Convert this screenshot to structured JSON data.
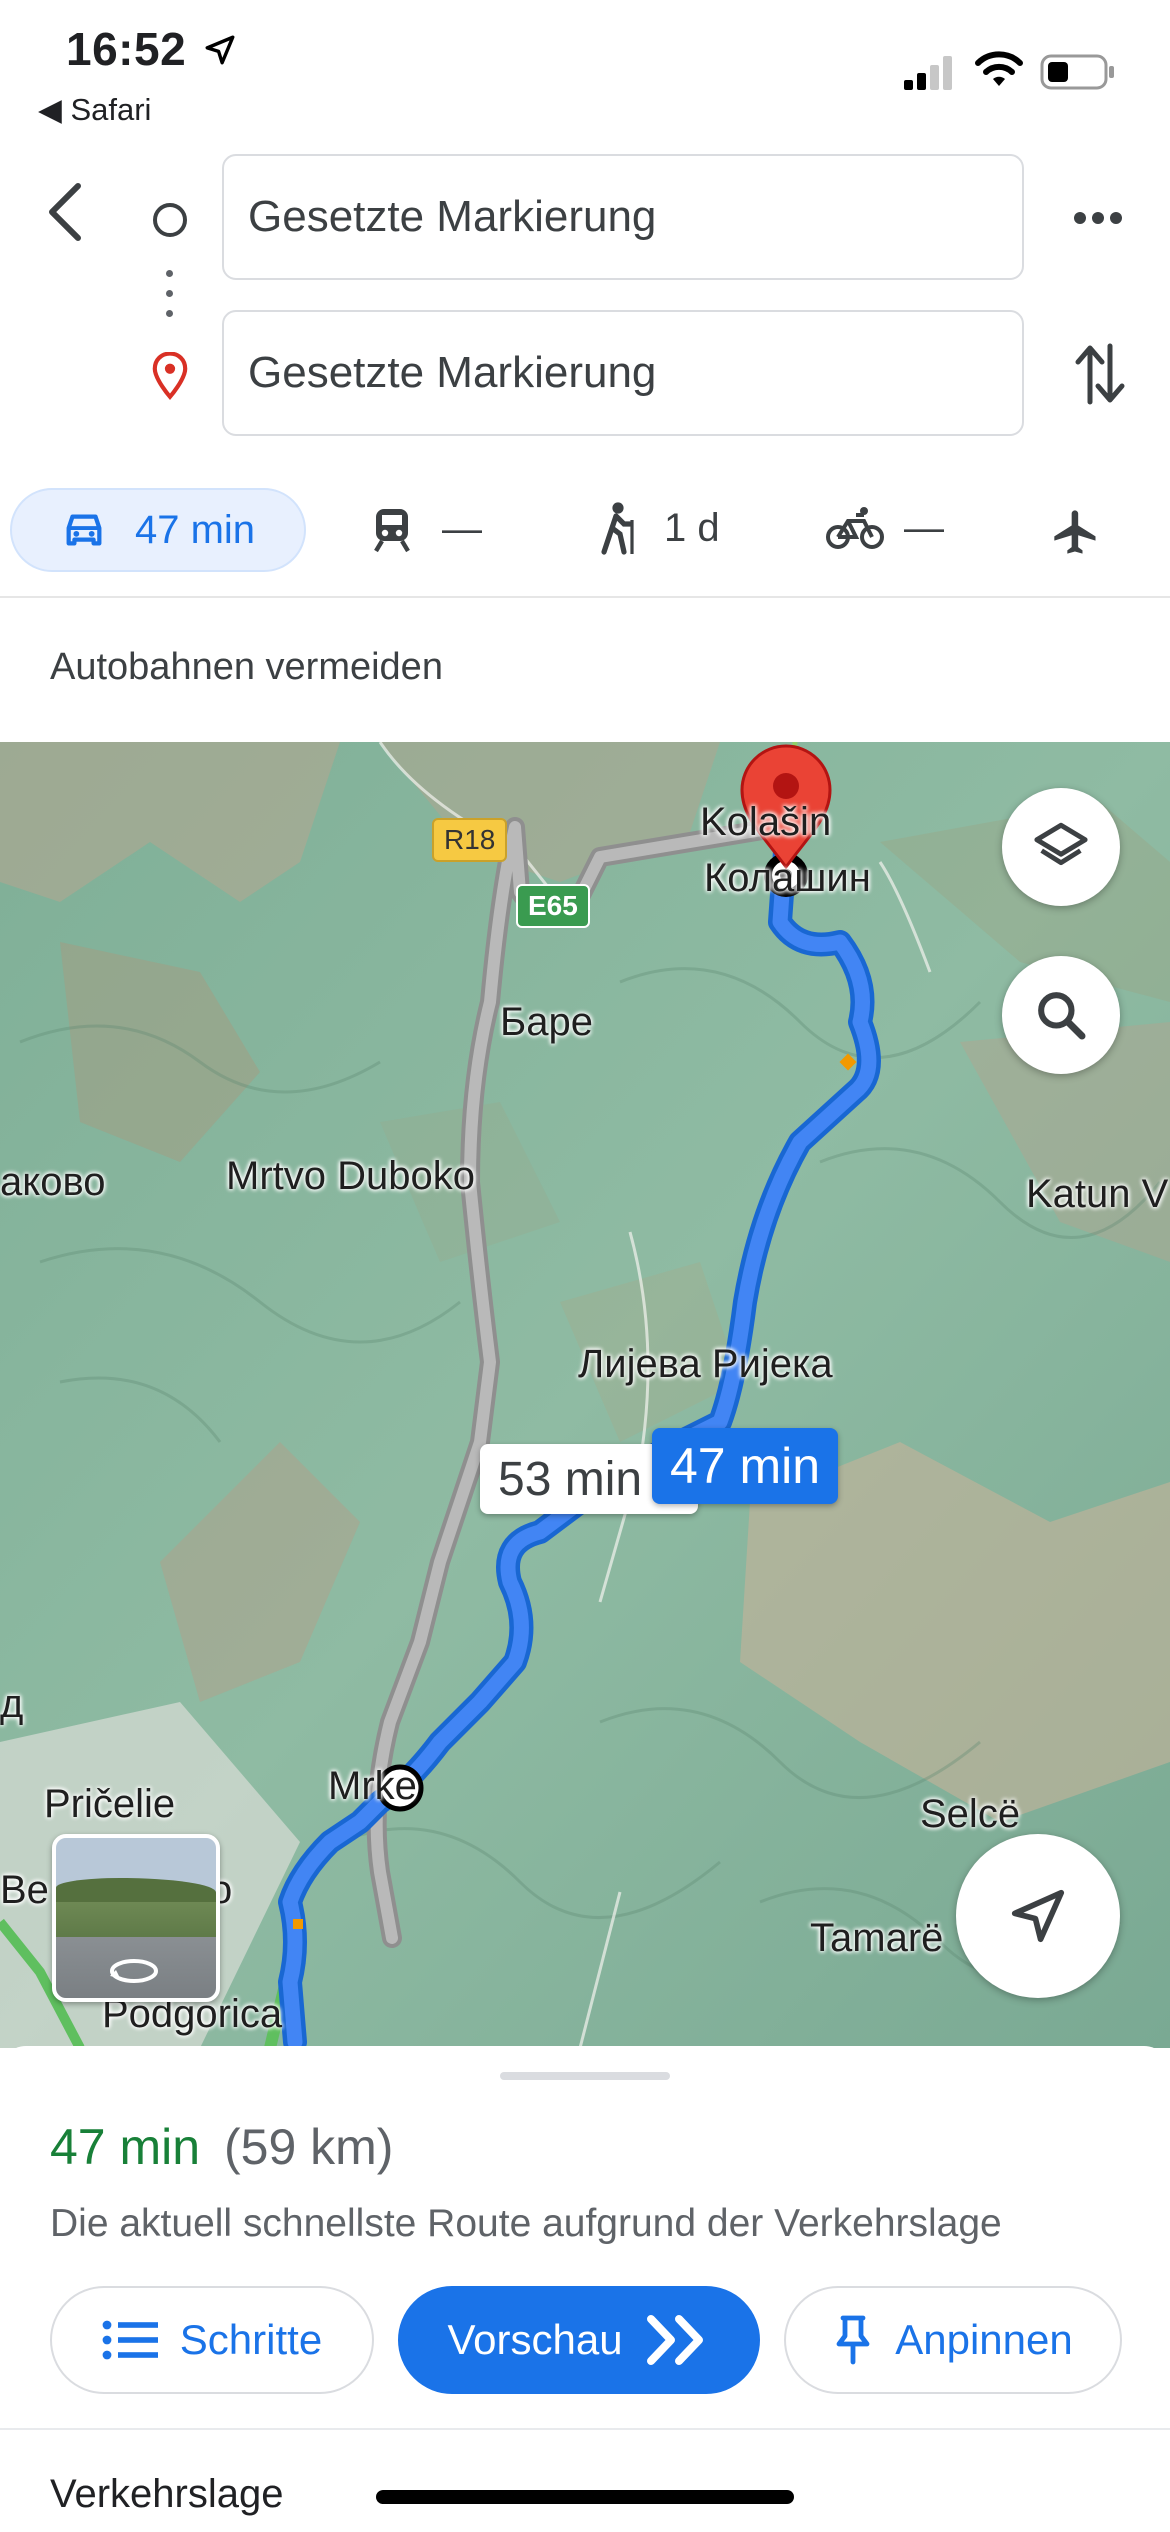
{
  "status_bar": {
    "time": "16:52",
    "back_app": "Safari",
    "icons": [
      "location-arrow-icon",
      "cellular-signal-icon",
      "wifi-icon",
      "battery-icon"
    ]
  },
  "directions": {
    "origin_value": "Gesetzte Markierung",
    "destination_value": "Gesetzte Markierung"
  },
  "modes": {
    "car": "47 min",
    "transit": "—",
    "walk": "1 d",
    "bike": "—"
  },
  "option_text": "Autobahnen vermeiden",
  "map": {
    "labels": {
      "kolasin_latin": "Kolašin",
      "kolasin_cyr": "Колашин",
      "bare": "Баре",
      "mrtvo_duboko": "Mrtvo Duboko",
      "akovo": "аково",
      "katun": "Katun V",
      "lijeva_rijeka": "Лијева Ријека",
      "pricelie": "Pričelie",
      "mrke": "Mrke",
      "podgorica": "Podgorica",
      "selce": "Selcë",
      "tamare": "Tamarë",
      "be": "Be",
      "d": "д",
      "o": "o"
    },
    "shields": {
      "r18": "R18",
      "e65": "E65"
    },
    "route_main_time": "47 min",
    "route_alt_time": "53 min",
    "colors": {
      "route": "#4285f4",
      "route_border": "#1967d2",
      "alt_route": "#a8a8a8",
      "terrain": "#86b39a"
    }
  },
  "sheet": {
    "duration": "47 min",
    "distance": "(59 km)",
    "description": "Die aktuell schnellste Route aufgrund der Verkehrslage",
    "steps_label": "Schritte",
    "preview_label": "Vorschau",
    "pin_label": "Anpinnen",
    "traffic_heading": "Verkehrslage"
  }
}
